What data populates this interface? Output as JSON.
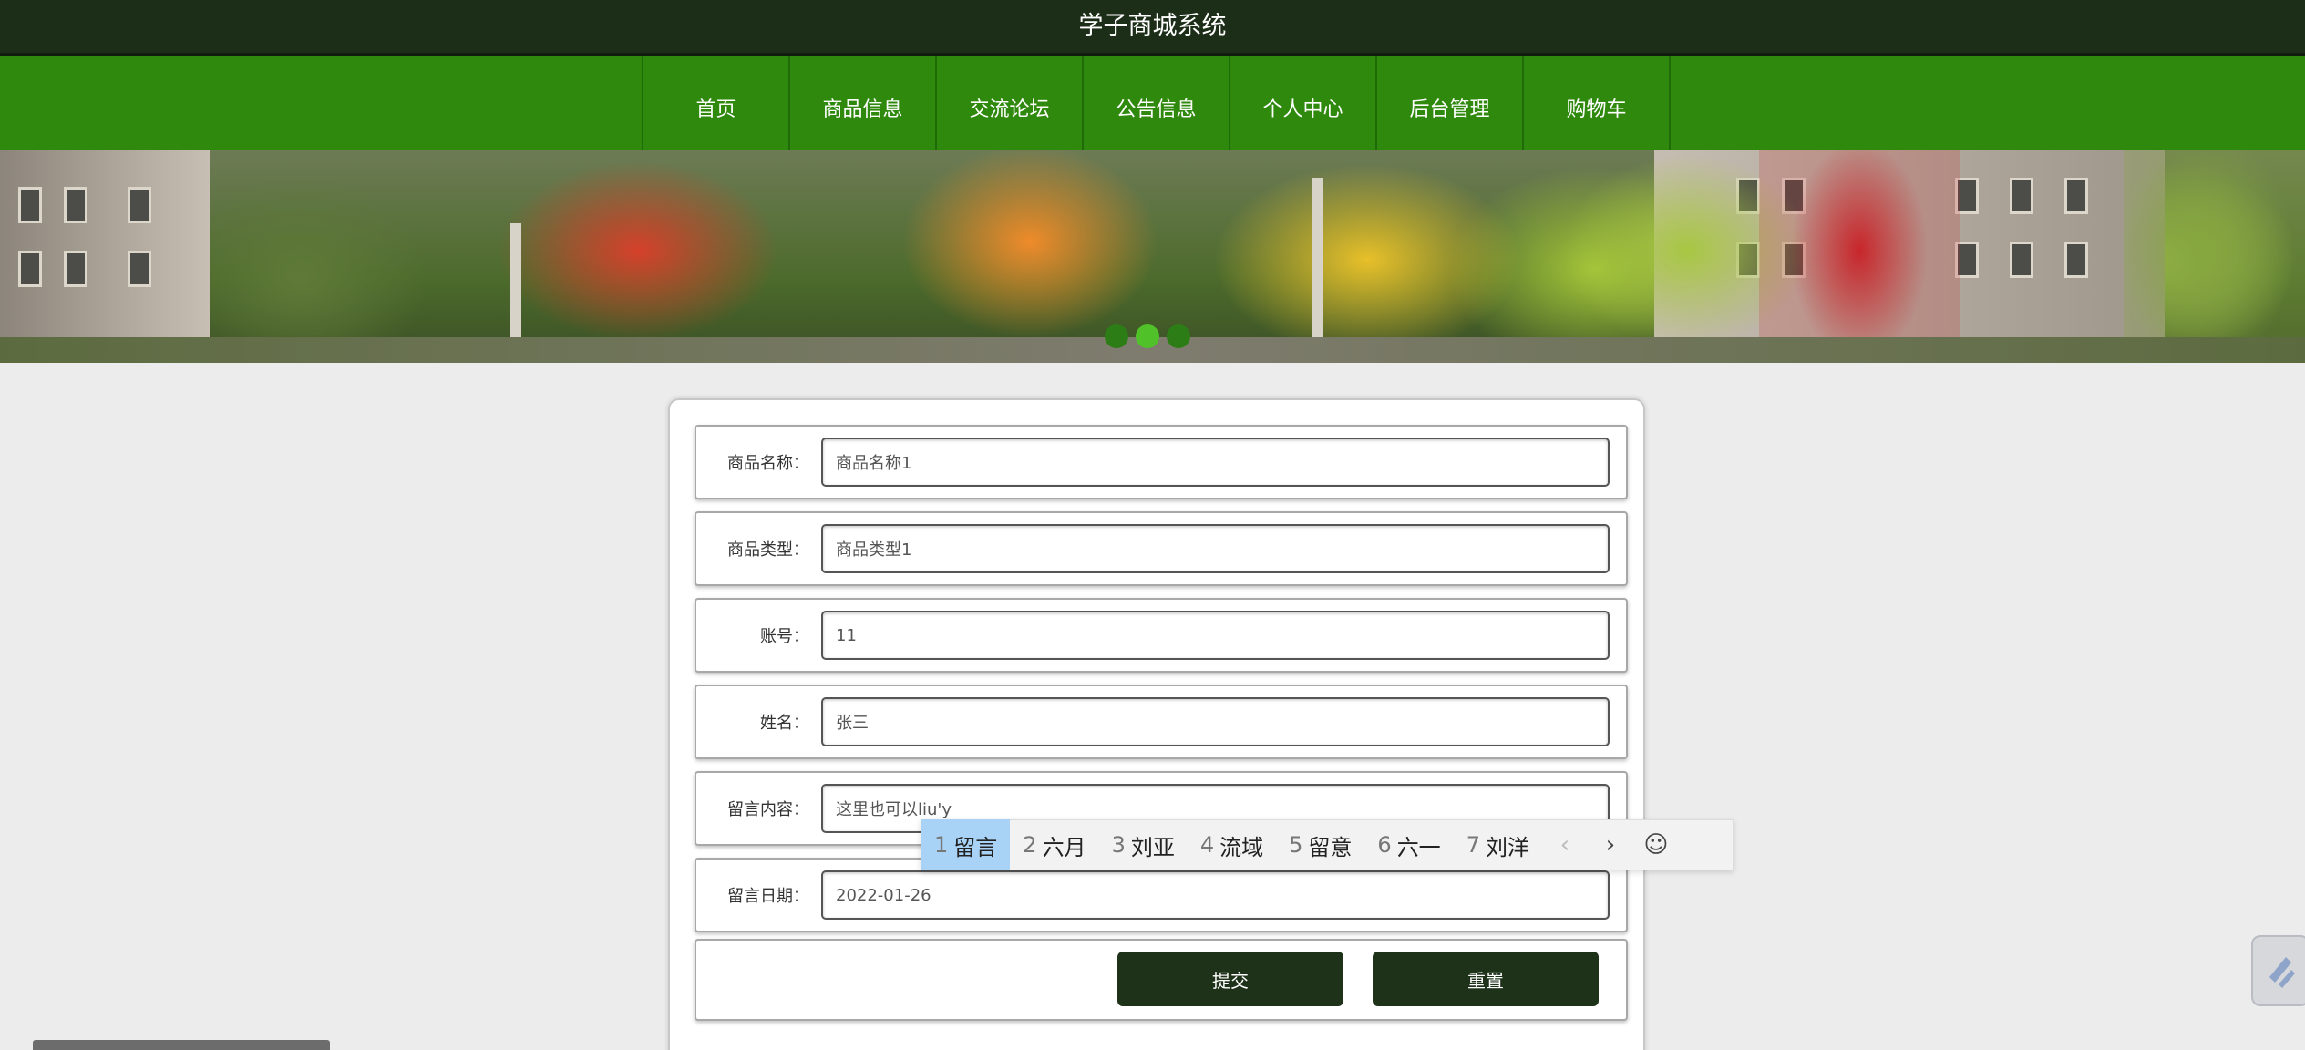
{
  "header": {
    "site_title": "学子商城系统"
  },
  "nav": {
    "items": [
      {
        "label": "首页"
      },
      {
        "label": "商品信息"
      },
      {
        "label": "交流论坛"
      },
      {
        "label": "公告信息"
      },
      {
        "label": "个人中心"
      },
      {
        "label": "后台管理"
      },
      {
        "label": "购物车"
      }
    ]
  },
  "banner": {
    "slide_count": 3,
    "active_slide": 2
  },
  "form": {
    "fields": [
      {
        "label": "商品名称：",
        "value": "商品名称1"
      },
      {
        "label": "商品类型：",
        "value": "商品类型1"
      },
      {
        "label": "账号：",
        "value": "11"
      },
      {
        "label": "姓名：",
        "value": "张三"
      },
      {
        "label": "留言内容：",
        "value": "这里也可以liu'y"
      },
      {
        "label": "留言日期：",
        "value": "2022-01-26"
      }
    ],
    "submit_label": "提交",
    "reset_label": "重置"
  },
  "ime": {
    "candidates": [
      {
        "num": "1",
        "text": "留言"
      },
      {
        "num": "2",
        "text": "六月"
      },
      {
        "num": "3",
        "text": "刘亚"
      },
      {
        "num": "4",
        "text": "流域"
      },
      {
        "num": "5",
        "text": "留意"
      },
      {
        "num": "6",
        "text": "六一"
      },
      {
        "num": "7",
        "text": "刘洋"
      }
    ],
    "prev_icon": "chevron-left-icon",
    "next_icon": "chevron-right-icon",
    "emoji_icon": "smiley-icon"
  },
  "colors": {
    "topbar": "#1c2e18",
    "nav": "#2f890d",
    "button": "#1d3219",
    "ime_selected": "#a9d3f6",
    "dot_active": "#51c12a"
  }
}
